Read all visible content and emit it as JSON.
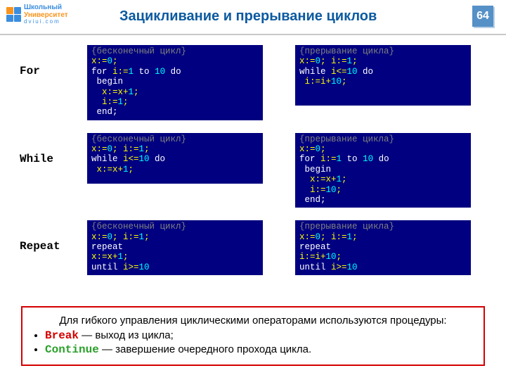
{
  "logo": {
    "line1": "Школьный",
    "line2": "Университет",
    "line3": "dviui.com"
  },
  "title": "Зацикливание и прерывание циклов",
  "page_number": "64",
  "rows": [
    {
      "label": "For",
      "left": [
        {
          "cls": "cmt",
          "t": "{бесконечный цикл}"
        },
        {
          "seg": [
            {
              "cls": "yel",
              "t": "x:="
            },
            {
              "cls": "cyn",
              "t": "0"
            },
            {
              "cls": "yel",
              "t": ";"
            }
          ]
        },
        {
          "seg": [
            {
              "cls": "wht",
              "t": "for "
            },
            {
              "cls": "yel",
              "t": "i:="
            },
            {
              "cls": "cyn",
              "t": "1"
            },
            {
              "cls": "wht",
              "t": " to "
            },
            {
              "cls": "cyn",
              "t": "10"
            },
            {
              "cls": "wht",
              "t": " do"
            }
          ]
        },
        {
          "cls": "wht",
          "t": " begin"
        },
        {
          "seg": [
            {
              "cls": "yel",
              "t": "  x:=x+"
            },
            {
              "cls": "cyn",
              "t": "1"
            },
            {
              "cls": "yel",
              "t": ";"
            }
          ]
        },
        {
          "seg": [
            {
              "cls": "yel",
              "t": "  i:="
            },
            {
              "cls": "cyn",
              "t": "1"
            },
            {
              "cls": "yel",
              "t": ";"
            }
          ]
        },
        {
          "cls": "wht",
          "t": " end;"
        }
      ],
      "right": [
        {
          "cls": "cmt",
          "t": "{прерывание цикла}"
        },
        {
          "seg": [
            {
              "cls": "yel",
              "t": "x:="
            },
            {
              "cls": "cyn",
              "t": "0"
            },
            {
              "cls": "yel",
              "t": "; i:="
            },
            {
              "cls": "cyn",
              "t": "1"
            },
            {
              "cls": "yel",
              "t": ";"
            }
          ]
        },
        {
          "seg": [
            {
              "cls": "wht",
              "t": "while "
            },
            {
              "cls": "yel",
              "t": "i<="
            },
            {
              "cls": "cyn",
              "t": "10 "
            },
            {
              "cls": "wht",
              "t": "do"
            }
          ]
        },
        {
          "seg": [
            {
              "cls": "yel",
              "t": " i:=i+"
            },
            {
              "cls": "cyn",
              "t": "10"
            },
            {
              "cls": "yel",
              "t": ";"
            }
          ]
        }
      ]
    },
    {
      "label": "While",
      "left": [
        {
          "cls": "cmt",
          "t": "{бесконечный цикл}"
        },
        {
          "seg": [
            {
              "cls": "yel",
              "t": "x:="
            },
            {
              "cls": "cyn",
              "t": "0"
            },
            {
              "cls": "yel",
              "t": "; i:="
            },
            {
              "cls": "cyn",
              "t": "1"
            },
            {
              "cls": "yel",
              "t": ";"
            }
          ]
        },
        {
          "seg": [
            {
              "cls": "wht",
              "t": "while "
            },
            {
              "cls": "yel",
              "t": "i<="
            },
            {
              "cls": "cyn",
              "t": "10 "
            },
            {
              "cls": "wht",
              "t": "do"
            }
          ]
        },
        {
          "seg": [
            {
              "cls": "yel",
              "t": " x:=x+"
            },
            {
              "cls": "cyn",
              "t": "1"
            },
            {
              "cls": "yel",
              "t": ";"
            }
          ]
        }
      ],
      "right": [
        {
          "cls": "cmt",
          "t": "{прерывание цикла}"
        },
        {
          "seg": [
            {
              "cls": "yel",
              "t": "x:="
            },
            {
              "cls": "cyn",
              "t": "0"
            },
            {
              "cls": "yel",
              "t": ";"
            }
          ]
        },
        {
          "seg": [
            {
              "cls": "wht",
              "t": "for "
            },
            {
              "cls": "yel",
              "t": "i:="
            },
            {
              "cls": "cyn",
              "t": "1"
            },
            {
              "cls": "wht",
              "t": " to "
            },
            {
              "cls": "cyn",
              "t": "10"
            },
            {
              "cls": "wht",
              "t": " do"
            }
          ]
        },
        {
          "cls": "wht",
          "t": " begin"
        },
        {
          "seg": [
            {
              "cls": "yel",
              "t": "  x:=x+"
            },
            {
              "cls": "cyn",
              "t": "1"
            },
            {
              "cls": "yel",
              "t": ";"
            }
          ]
        },
        {
          "seg": [
            {
              "cls": "yel",
              "t": "  i:="
            },
            {
              "cls": "cyn",
              "t": "10"
            },
            {
              "cls": "yel",
              "t": ";"
            }
          ]
        },
        {
          "cls": "wht",
          "t": " end;"
        }
      ]
    },
    {
      "label": "Repeat",
      "left": [
        {
          "cls": "cmt",
          "t": "{бесконечный цикл}"
        },
        {
          "seg": [
            {
              "cls": "yel",
              "t": "x:="
            },
            {
              "cls": "cyn",
              "t": "0"
            },
            {
              "cls": "yel",
              "t": "; i:="
            },
            {
              "cls": "cyn",
              "t": "1"
            },
            {
              "cls": "yel",
              "t": ";"
            }
          ]
        },
        {
          "cls": "wht",
          "t": "repeat"
        },
        {
          "seg": [
            {
              "cls": "yel",
              "t": "x:=x+"
            },
            {
              "cls": "cyn",
              "t": "1"
            },
            {
              "cls": "yel",
              "t": ";"
            }
          ]
        },
        {
          "seg": [
            {
              "cls": "wht",
              "t": "until "
            },
            {
              "cls": "yel",
              "t": "i>="
            },
            {
              "cls": "cyn",
              "t": "10"
            }
          ]
        }
      ],
      "right": [
        {
          "cls": "cmt",
          "t": "{прерывание цикла}"
        },
        {
          "seg": [
            {
              "cls": "yel",
              "t": "x:="
            },
            {
              "cls": "cyn",
              "t": "0"
            },
            {
              "cls": "yel",
              "t": "; i:="
            },
            {
              "cls": "cyn",
              "t": "1"
            },
            {
              "cls": "yel",
              "t": ";"
            }
          ]
        },
        {
          "cls": "wht",
          "t": "repeat"
        },
        {
          "seg": [
            {
              "cls": "yel",
              "t": "i:=i+"
            },
            {
              "cls": "cyn",
              "t": "10"
            },
            {
              "cls": "yel",
              "t": ";"
            }
          ]
        },
        {
          "seg": [
            {
              "cls": "wht",
              "t": "until "
            },
            {
              "cls": "yel",
              "t": "i>="
            },
            {
              "cls": "cyn",
              "t": "10"
            }
          ]
        }
      ]
    }
  ],
  "footer": {
    "intro": "Для гибкого управления циклическими операторами используются процедуры:",
    "break_kw": "Break",
    "break_txt": " — выход из цикла;",
    "continue_kw": "Continue",
    "continue_txt": " — завершение очередного прохода цикла."
  }
}
